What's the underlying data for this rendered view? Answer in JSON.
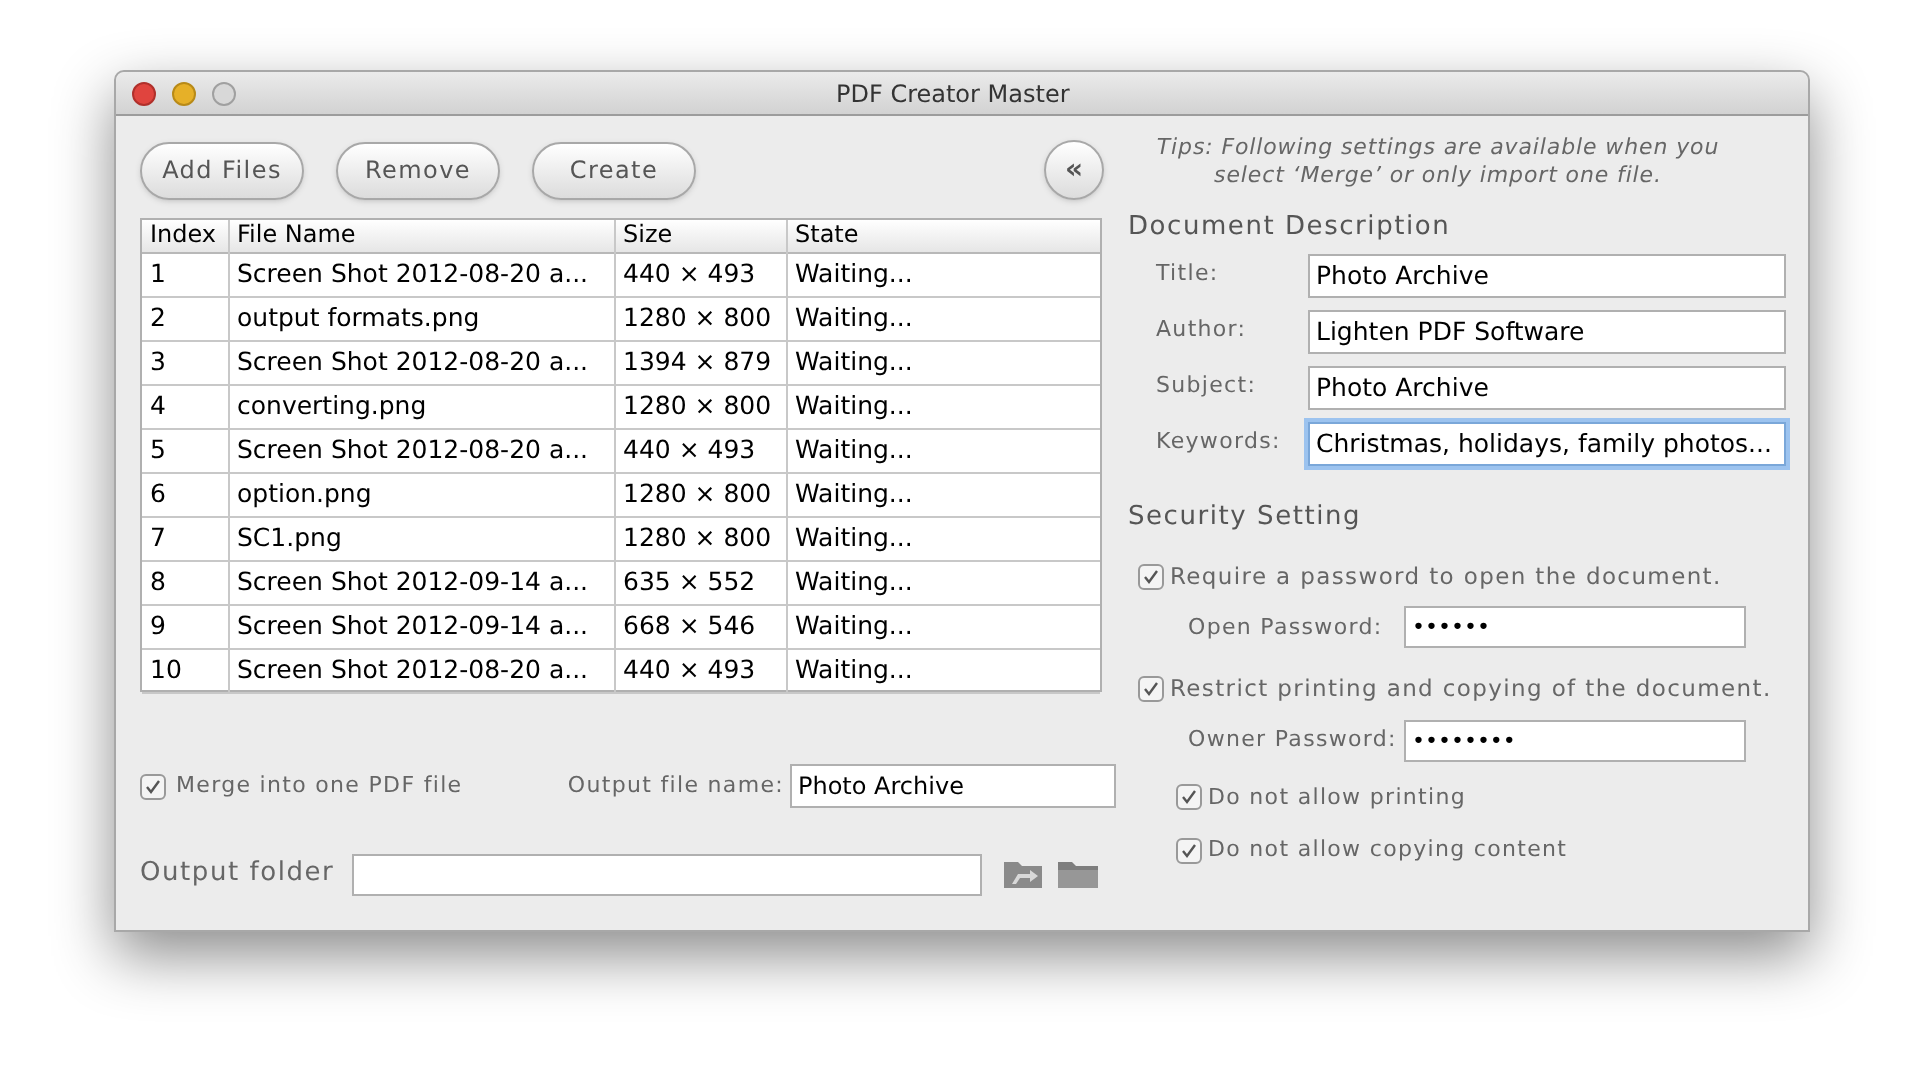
{
  "window": {
    "title": "PDF Creator Master"
  },
  "toolbar": {
    "buttons": [
      "Add Files",
      "Remove",
      "Create"
    ],
    "collapse_button": "«"
  },
  "table": {
    "columns": [
      "Index",
      "File Name",
      "Size",
      "State"
    ],
    "rows": [
      {
        "cells": [
          "1",
          "Screen Shot 2012-08-20 a...",
          "440 × 493",
          "Waiting..."
        ]
      },
      {
        "cells": [
          "2",
          "output formats.png",
          "1280 × 800",
          "Waiting..."
        ]
      },
      {
        "cells": [
          "3",
          "Screen Shot 2012-08-20 a...",
          "1394 × 879",
          "Waiting..."
        ]
      },
      {
        "cells": [
          "4",
          "converting.png",
          "1280 × 800",
          "Waiting..."
        ]
      },
      {
        "cells": [
          "5",
          "Screen Shot 2012-08-20 a...",
          "440 × 493",
          "Waiting..."
        ]
      },
      {
        "cells": [
          "6",
          "option.png",
          "1280 × 800",
          "Waiting..."
        ]
      },
      {
        "cells": [
          "7",
          "SC1.png",
          "1280 × 800",
          "Waiting..."
        ]
      },
      {
        "cells": [
          "8",
          "Screen Shot 2012-09-14 a...",
          "635 × 552",
          "Waiting..."
        ]
      },
      {
        "cells": [
          "9",
          "Screen Shot 2012-09-14 a...",
          "668 × 546",
          "Waiting..."
        ]
      },
      {
        "cells": [
          "10",
          "Screen Shot 2012-08-20 a...",
          "440 × 493",
          "Waiting..."
        ]
      }
    ]
  },
  "merge": {
    "label": "Merge into one PDF file",
    "checked": true
  },
  "output_file_name": {
    "label": "Output file name:",
    "value": "Photo Archive"
  },
  "output_folder": {
    "label": "Output folder"
  },
  "tips": "Tips: Following settings are available when you select ‘Merge’ or only import one file.",
  "document_description": {
    "heading": "Document Description",
    "fields": [
      {
        "label": "Title:",
        "value": "Photo Archive",
        "focused": false
      },
      {
        "label": "Author:",
        "value": "Lighten PDF Software",
        "focused": false
      },
      {
        "label": "Subject:",
        "value": "Photo Archive",
        "focused": false
      },
      {
        "label": "Keywords:",
        "value": "Christmas, holidays, family photos...",
        "focused": true
      }
    ]
  },
  "security": {
    "heading": "Security Setting",
    "items": [
      {
        "kind": "checkbox",
        "label": "Require a password to open the document.",
        "checked": true
      },
      {
        "kind": "password",
        "label": "Open Password:",
        "value": "••••••"
      },
      {
        "kind": "checkbox",
        "label": "Restrict printing and copying of the document.",
        "checked": true
      },
      {
        "kind": "password",
        "label": "Owner Password:",
        "value": "••••••••"
      },
      {
        "kind": "option",
        "label": "Do not allow printing",
        "checked": true
      },
      {
        "kind": "option",
        "label": "Do not allow copying content",
        "checked": true
      }
    ]
  }
}
